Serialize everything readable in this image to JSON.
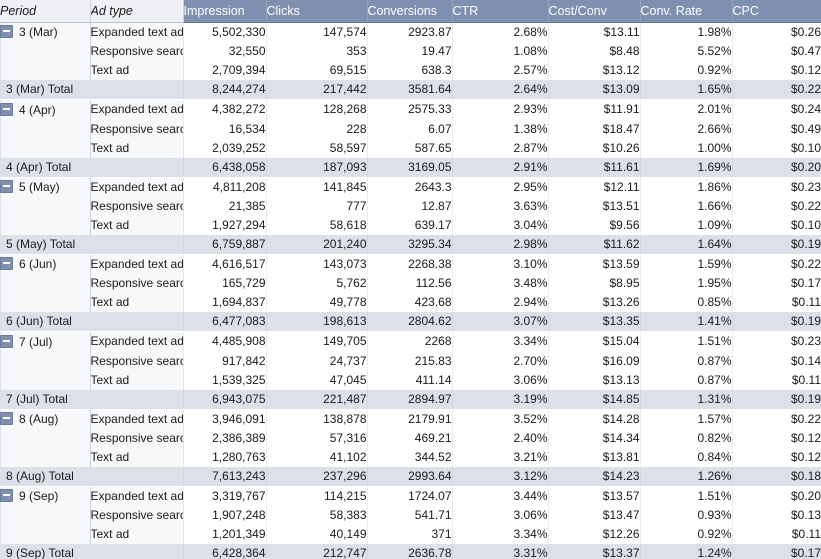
{
  "table": {
    "row_fields": [
      {
        "key": "period",
        "label": "Period",
        "width": 90
      },
      {
        "key": "adtype",
        "label": "Ad type",
        "width": 93
      }
    ],
    "measures": [
      {
        "key": "impression",
        "label": "Impression",
        "width": 83
      },
      {
        "key": "clicks",
        "label": "Clicks",
        "width": 101
      },
      {
        "key": "conversions",
        "label": "Conversions",
        "width": 85
      },
      {
        "key": "ctr",
        "label": "CTR",
        "width": 96
      },
      {
        "key": "costconv",
        "label": "Cost/Conv",
        "width": 92
      },
      {
        "key": "convrate",
        "label": "Conv. Rate",
        "width": 92
      },
      {
        "key": "cpc",
        "label": "CPC",
        "width": 89
      }
    ],
    "expander_icon": "minus-square-collapse-icon",
    "ad_types": [
      "Expanded text ad",
      "Responsive search ad",
      "Text ad"
    ],
    "colors": {
      "header_measure_bg": "#7e8fb0",
      "header_rowfield_bg": "#eef0f4",
      "total_row_bg": "#dce0e9",
      "row_field_bg": "#f7f8fa",
      "data_bg": "#ffffff",
      "text": "#1a1a1a",
      "header_measure_text": "#ffffff"
    },
    "groups": [
      {
        "period": "3 (Mar)",
        "rows": [
          {
            "adtype": "Expanded text ad",
            "impression": "5,502,330",
            "clicks": "147,574",
            "conversions": "2923.87",
            "ctr": "2.68%",
            "costconv": "$13.11",
            "convrate": "1.98%",
            "cpc": "$0.26"
          },
          {
            "adtype": "Responsive search ad",
            "impression": "32,550",
            "clicks": "353",
            "conversions": "19.47",
            "ctr": "1.08%",
            "costconv": "$8.48",
            "convrate": "5.52%",
            "cpc": "$0.47"
          },
          {
            "adtype": "Text ad",
            "impression": "2,709,394",
            "clicks": "69,515",
            "conversions": "638.3",
            "ctr": "2.57%",
            "costconv": "$13.12",
            "convrate": "0.92%",
            "cpc": "$0.12"
          }
        ],
        "total": {
          "label": "3 (Mar) Total",
          "impression": "8,244,274",
          "clicks": "217,442",
          "conversions": "3581.64",
          "ctr": "2.64%",
          "costconv": "$13.09",
          "convrate": "1.65%",
          "cpc": "$0.22"
        }
      },
      {
        "period": "4 (Apr)",
        "rows": [
          {
            "adtype": "Expanded text ad",
            "impression": "4,382,272",
            "clicks": "128,268",
            "conversions": "2575.33",
            "ctr": "2.93%",
            "costconv": "$11.91",
            "convrate": "2.01%",
            "cpc": "$0.24"
          },
          {
            "adtype": "Responsive search ad",
            "impression": "16,534",
            "clicks": "228",
            "conversions": "6.07",
            "ctr": "1.38%",
            "costconv": "$18.47",
            "convrate": "2.66%",
            "cpc": "$0.49"
          },
          {
            "adtype": "Text ad",
            "impression": "2,039,252",
            "clicks": "58,597",
            "conversions": "587.65",
            "ctr": "2.87%",
            "costconv": "$10.26",
            "convrate": "1.00%",
            "cpc": "$0.10"
          }
        ],
        "total": {
          "label": "4 (Apr) Total",
          "impression": "6,438,058",
          "clicks": "187,093",
          "conversions": "3169.05",
          "ctr": "2.91%",
          "costconv": "$11.61",
          "convrate": "1.69%",
          "cpc": "$0.20"
        }
      },
      {
        "period": "5 (May)",
        "rows": [
          {
            "adtype": "Expanded text ad",
            "impression": "4,811,208",
            "clicks": "141,845",
            "conversions": "2643.3",
            "ctr": "2.95%",
            "costconv": "$12.11",
            "convrate": "1.86%",
            "cpc": "$0.23"
          },
          {
            "adtype": "Responsive search ad",
            "impression": "21,385",
            "clicks": "777",
            "conversions": "12.87",
            "ctr": "3.63%",
            "costconv": "$13.51",
            "convrate": "1.66%",
            "cpc": "$0.22"
          },
          {
            "adtype": "Text ad",
            "impression": "1,927,294",
            "clicks": "58,618",
            "conversions": "639.17",
            "ctr": "3.04%",
            "costconv": "$9.56",
            "convrate": "1.09%",
            "cpc": "$0.10"
          }
        ],
        "total": {
          "label": "5 (May) Total",
          "impression": "6,759,887",
          "clicks": "201,240",
          "conversions": "3295.34",
          "ctr": "2.98%",
          "costconv": "$11.62",
          "convrate": "1.64%",
          "cpc": "$0.19"
        }
      },
      {
        "period": "6 (Jun)",
        "rows": [
          {
            "adtype": "Expanded text ad",
            "impression": "4,616,517",
            "clicks": "143,073",
            "conversions": "2268.38",
            "ctr": "3.10%",
            "costconv": "$13.59",
            "convrate": "1.59%",
            "cpc": "$0.22"
          },
          {
            "adtype": "Responsive search ad",
            "impression": "165,729",
            "clicks": "5,762",
            "conversions": "112.56",
            "ctr": "3.48%",
            "costconv": "$8.95",
            "convrate": "1.95%",
            "cpc": "$0.17"
          },
          {
            "adtype": "Text ad",
            "impression": "1,694,837",
            "clicks": "49,778",
            "conversions": "423.68",
            "ctr": "2.94%",
            "costconv": "$13.26",
            "convrate": "0.85%",
            "cpc": "$0.11"
          }
        ],
        "total": {
          "label": "6 (Jun) Total",
          "impression": "6,477,083",
          "clicks": "198,613",
          "conversions": "2804.62",
          "ctr": "3.07%",
          "costconv": "$13.35",
          "convrate": "1.41%",
          "cpc": "$0.19"
        }
      },
      {
        "period": "7 (Jul)",
        "rows": [
          {
            "adtype": "Expanded text ad",
            "impression": "4,485,908",
            "clicks": "149,705",
            "conversions": "2268",
            "ctr": "3.34%",
            "costconv": "$15.04",
            "convrate": "1.51%",
            "cpc": "$0.23"
          },
          {
            "adtype": "Responsive search ad",
            "impression": "917,842",
            "clicks": "24,737",
            "conversions": "215.83",
            "ctr": "2.70%",
            "costconv": "$16.09",
            "convrate": "0.87%",
            "cpc": "$0.14"
          },
          {
            "adtype": "Text ad",
            "impression": "1,539,325",
            "clicks": "47,045",
            "conversions": "411.14",
            "ctr": "3.06%",
            "costconv": "$13.13",
            "convrate": "0.87%",
            "cpc": "$0.11"
          }
        ],
        "total": {
          "label": "7 (Jul) Total",
          "impression": "6,943,075",
          "clicks": "221,487",
          "conversions": "2894.97",
          "ctr": "3.19%",
          "costconv": "$14.85",
          "convrate": "1.31%",
          "cpc": "$0.19"
        }
      },
      {
        "period": "8 (Aug)",
        "rows": [
          {
            "adtype": "Expanded text ad",
            "impression": "3,946,091",
            "clicks": "138,878",
            "conversions": "2179.91",
            "ctr": "3.52%",
            "costconv": "$14.28",
            "convrate": "1.57%",
            "cpc": "$0.22"
          },
          {
            "adtype": "Responsive search ad",
            "impression": "2,386,389",
            "clicks": "57,316",
            "conversions": "469.21",
            "ctr": "2.40%",
            "costconv": "$14.34",
            "convrate": "0.82%",
            "cpc": "$0.12"
          },
          {
            "adtype": "Text ad",
            "impression": "1,280,763",
            "clicks": "41,102",
            "conversions": "344.52",
            "ctr": "3.21%",
            "costconv": "$13.81",
            "convrate": "0.84%",
            "cpc": "$0.12"
          }
        ],
        "total": {
          "label": "8 (Aug) Total",
          "impression": "7,613,243",
          "clicks": "237,296",
          "conversions": "2993.64",
          "ctr": "3.12%",
          "costconv": "$14.23",
          "convrate": "1.26%",
          "cpc": "$0.18"
        }
      },
      {
        "period": "9 (Sep)",
        "rows": [
          {
            "adtype": "Expanded text ad",
            "impression": "3,319,767",
            "clicks": "114,215",
            "conversions": "1724.07",
            "ctr": "3.44%",
            "costconv": "$13.57",
            "convrate": "1.51%",
            "cpc": "$0.20"
          },
          {
            "adtype": "Responsive search ad",
            "impression": "1,907,248",
            "clicks": "58,383",
            "conversions": "541.71",
            "ctr": "3.06%",
            "costconv": "$13.47",
            "convrate": "0.93%",
            "cpc": "$0.13"
          },
          {
            "adtype": "Text ad",
            "impression": "1,201,349",
            "clicks": "40,149",
            "conversions": "371",
            "ctr": "3.34%",
            "costconv": "$12.26",
            "convrate": "0.92%",
            "cpc": "$0.11"
          }
        ],
        "total": {
          "label": "9 (Sep) Total",
          "impression": "6,428,364",
          "clicks": "212,747",
          "conversions": "2636.78",
          "ctr": "3.31%",
          "costconv": "$13.37",
          "convrate": "1.24%",
          "cpc": "$0.17"
        }
      }
    ]
  }
}
